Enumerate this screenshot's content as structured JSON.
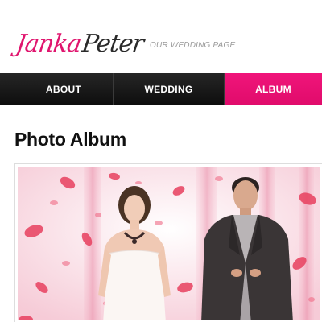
{
  "logo": {
    "first": "Janka",
    "second": "Peter"
  },
  "tagline": "OUR WEDDING PAGE",
  "nav": {
    "items": [
      {
        "label": "ABOUT"
      },
      {
        "label": "WEDDING"
      },
      {
        "label": "ALBUM"
      }
    ],
    "active": "ALBUM"
  },
  "page_title": "Photo Album",
  "colors": {
    "accent": "#e60f71",
    "nav_bg": "#1a1a1a",
    "title": "#111111"
  },
  "photo": {
    "subject": "bride-and-groom-petals-photo"
  }
}
